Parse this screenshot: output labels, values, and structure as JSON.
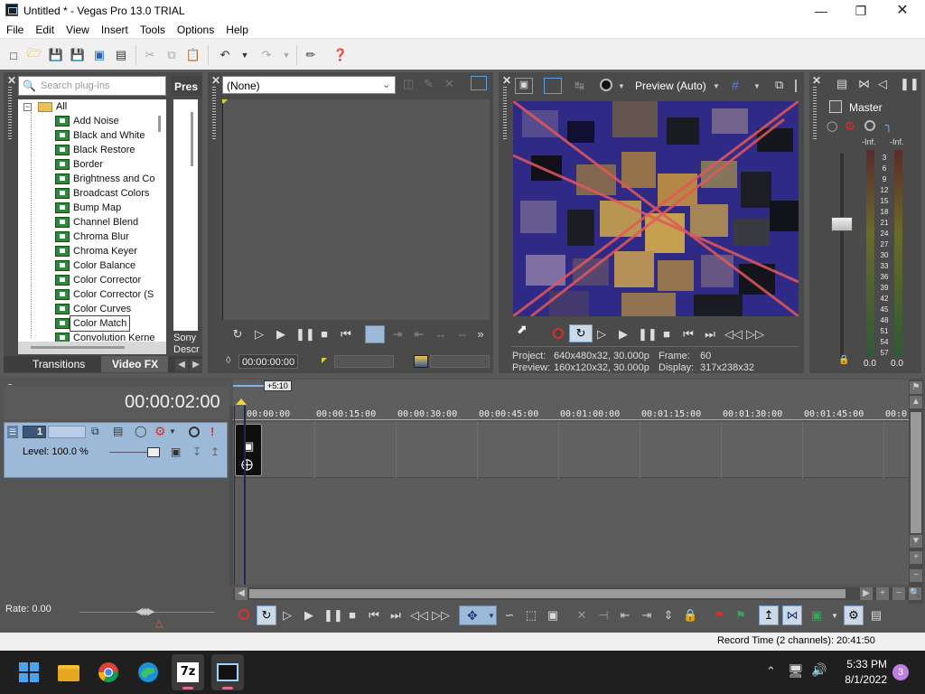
{
  "window": {
    "title": "Untitled * - Vegas Pro 13.0 TRIAL"
  },
  "menu": [
    "File",
    "Edit",
    "View",
    "Insert",
    "Tools",
    "Options",
    "Help"
  ],
  "plugins": {
    "search_placeholder": "Search plug-ins",
    "root": "All",
    "items": [
      "Add Noise",
      "Black and White",
      "Black Restore",
      "Border",
      "Brightness and Co",
      "Broadcast Colors",
      "Bump Map",
      "Channel Blend",
      "Chroma Blur",
      "Chroma Keyer",
      "Color Balance",
      "Color Corrector",
      "Color Corrector (S",
      "Color Curves",
      "Color Match",
      "Convolution Kerne"
    ],
    "selected": "Color Match",
    "presets_header": "Pres",
    "desc_line1": "Sony",
    "desc_line2": "Descr"
  },
  "tabs": {
    "transitions": "Transitions",
    "video_fx": "Video FX"
  },
  "trimmer": {
    "dropdown_value": "(None)",
    "timecode": "00:00:00:00"
  },
  "preview": {
    "mode": "Preview (Auto)",
    "project_label": "Project:",
    "project_value": "640x480x32, 30.000p",
    "preview_label": "Preview:",
    "preview_value": "160x120x32, 30.000p",
    "frame_label": "Frame:",
    "frame_value": "60",
    "display_label": "Display:",
    "display_value": "317x238x32"
  },
  "mixer": {
    "master_label": "Master",
    "meter_top_left": "-Inf.",
    "meter_top_right": "-Inf.",
    "scale": [
      "3",
      "6",
      "9",
      "12",
      "15",
      "18",
      "21",
      "24",
      "27",
      "30",
      "33",
      "36",
      "39",
      "42",
      "45",
      "48",
      "51",
      "54",
      "57"
    ],
    "bottom_left": "0.0",
    "bottom_right": "0.0"
  },
  "timeline": {
    "cursor_time": "00:00:02:00",
    "region_marker": "+5:10",
    "ruler": [
      "00:00:00",
      "00:00:15:00",
      "00:00:30:00",
      "00:00:45:00",
      "00:01:00:00",
      "00:01:15:00",
      "00:01:30:00",
      "00:01:45:00",
      "00:0"
    ],
    "track_number": "1",
    "level": "Level: 100.0 %",
    "rate": "Rate: 0.00"
  },
  "status": {
    "record_time": "Record Time (2 channels): 20:41:50"
  },
  "taskbar": {
    "time": "5:33 PM",
    "date": "8/1/2022",
    "notifications": "3"
  },
  "colors": {
    "accent": "#9db9d8",
    "workspace": "#5a5a5a",
    "panel": "#4a4a4a",
    "record": "#d9302a"
  }
}
